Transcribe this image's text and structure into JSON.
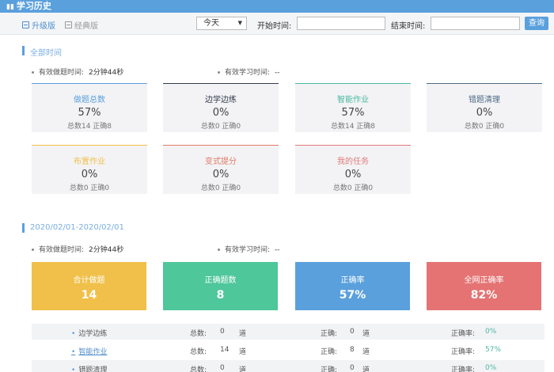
{
  "app": {
    "title": "学习历史"
  },
  "toolbar": {
    "upgrade_label": "升级版",
    "classic_label": "经典版",
    "range_selected": "今天",
    "start_label": "开始时间:",
    "end_label": "结束时间:",
    "query_label": "查询"
  },
  "all_time": {
    "title": "全部时间",
    "effective_label": "有效做题时间:",
    "effective_value": "2分钟44秒",
    "study_label": "有效学习时间:",
    "study_value": "--",
    "cards": [
      {
        "title": "做题总数",
        "percent": "57%",
        "stats": "总数14 正确8",
        "accent": "#5aa0dd"
      },
      {
        "title": "边学边练",
        "percent": "0%",
        "stats": "总数0 正确0",
        "accent": "#333a4d"
      },
      {
        "title": "智能作业",
        "percent": "57%",
        "stats": "总数14 正确8",
        "accent": "#4ab8a2"
      },
      {
        "title": "错题清理",
        "percent": "0%",
        "stats": "总数0 正确0",
        "accent": "#4d6b86"
      },
      {
        "title": "布置作业",
        "percent": "0%",
        "stats": "总数0 正确0",
        "accent": "#f0c04a"
      },
      {
        "title": "变式提分",
        "percent": "0%",
        "stats": "总数0 正确0",
        "accent": "#e07a64"
      },
      {
        "title": "我的任务",
        "percent": "0%",
        "stats": "总数0 正确0",
        "accent": "#e07a7a"
      }
    ]
  },
  "range": {
    "title": "2020/02/01-2020/02/01",
    "effective_label": "有效做题时间:",
    "effective_value": "2分钟44秒",
    "study_label": "有效学习时间:",
    "study_value": "--",
    "summary": [
      {
        "title": "合计做题",
        "value": "14",
        "color": "#f0c04a"
      },
      {
        "title": "正确题数",
        "value": "8",
        "color": "#4ec79a"
      },
      {
        "title": "正确率",
        "value": "57%",
        "color": "#5aa0dd"
      },
      {
        "title": "全网正确率",
        "value": "82%",
        "color": "#e57373"
      }
    ],
    "rows": [
      {
        "name": "边学边练",
        "total_label": "总数:",
        "total": "0",
        "unit1": "道",
        "correct_label": "正确:",
        "correct": "0",
        "unit2": "道",
        "rate_label": "正确率:",
        "rate": "0%"
      },
      {
        "name": "智能作业",
        "total_label": "总数:",
        "total": "14",
        "unit1": "道",
        "correct_label": "正确:",
        "correct": "8",
        "unit2": "道",
        "rate_label": "正确率:",
        "rate": "57%"
      },
      {
        "name": "错题清理",
        "total_label": "总数:",
        "total": "0",
        "unit1": "道",
        "correct_label": "正确:",
        "correct": "0",
        "unit2": "道",
        "rate_label": "正确率:",
        "rate": "0%"
      }
    ]
  }
}
